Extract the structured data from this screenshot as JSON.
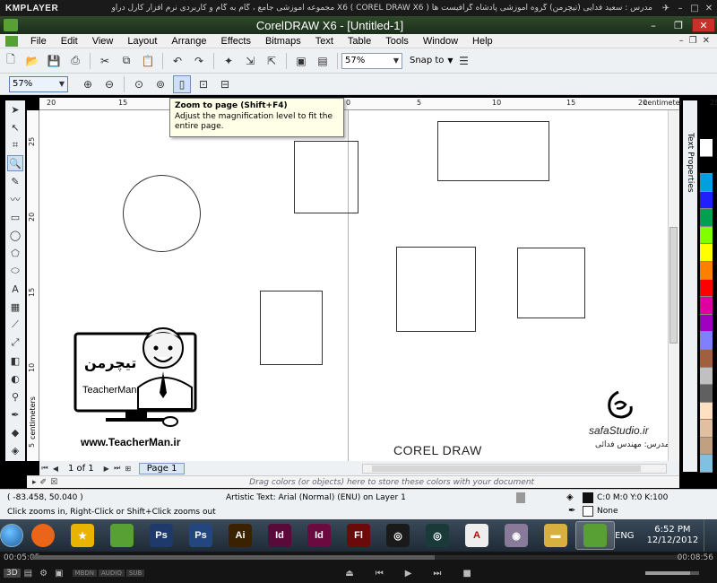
{
  "kmplayer": {
    "logo": "KMPLAYER",
    "caption": "مجموعه آموزشی جامع ، گام به گام و کاربردی نرم افزار کارل دراو X6 ( COREL DRAW X6 )   مدرس : سعید فدایی (تیچرمن) گروه آموزشی پادشاه گرافیست ها",
    "elapsed": "00:05:05",
    "total": "00:08:56",
    "seek_fraction": 0.62,
    "mode_3d": "3D",
    "modes": [
      "MBDN",
      "AUDIO",
      "SUB"
    ]
  },
  "window": {
    "title": "CorelDRAW X6 - [Untitled-1]",
    "min_icon": "minimize-icon",
    "max_icon": "maximize-icon",
    "close_icon": "close-icon"
  },
  "menu": {
    "items": [
      "File",
      "Edit",
      "View",
      "Layout",
      "Arrange",
      "Effects",
      "Bitmaps",
      "Text",
      "Table",
      "Tools",
      "Window",
      "Help"
    ]
  },
  "toolbar": {
    "zoom_value": "57%",
    "snap_label": "Snap to"
  },
  "zoombar": {
    "zoom_value": "57%"
  },
  "tooltip": {
    "title": "Zoom to page (Shift+F4)",
    "body": "Adjust the magnification level to fit the entire page."
  },
  "ruler": {
    "h_ticks": [
      {
        "label": "20",
        "value": 20
      },
      {
        "label": "15",
        "value": 15
      },
      {
        "label": "10",
        "value": 10
      },
      {
        "label": "5",
        "value": 5
      },
      {
        "label": "0",
        "value": 0
      },
      {
        "label": "5",
        "value": -5
      },
      {
        "label": "10",
        "value": -10
      },
      {
        "label": "15",
        "value": -15
      },
      {
        "label": "20",
        "value": -20
      },
      {
        "label": "25",
        "value": -25
      }
    ],
    "v_ticks": [
      "25",
      "20",
      "15",
      "10",
      "5"
    ],
    "unit": "centimeters"
  },
  "dock": {
    "label": "Text Properties"
  },
  "palette": {
    "colors": [
      "#ffffff",
      "#000000",
      "#00a0e0",
      "#2020ff",
      "#00a050",
      "#80ff00",
      "#ffff00",
      "#ff8000",
      "#ff0000",
      "#e000a0",
      "#a000c0",
      "#8080ff",
      "#a06040",
      "#c0c0c0",
      "#606060",
      "#ffe0c0",
      "#e0c0a0",
      "#c0a080",
      "#80c0e0"
    ]
  },
  "pagenav": {
    "count": "1 of 1",
    "page_tab": "Page 1"
  },
  "docpalette": {
    "hint": "Drag colors (or objects) here to store these colors with your document"
  },
  "canvas": {
    "watermark_url": "www.TeacherMan.ir",
    "logo_title": "تیچرمن",
    "logo_sub": "TeacherMan",
    "corel_text": "COREL DRAW",
    "safa_text": "safaStudio.ir",
    "safa_sub": "مدرس: مهندس فدائی"
  },
  "status": {
    "coords": "( -83.458, 50.040 )",
    "object": "Artistic Text: Arial (Normal) (ENU) on Layer 1",
    "hint": "Click zooms in, Right-Click or Shift+Click zooms out",
    "fill": "C:0 M:0 Y:0 K:100",
    "outline": "None"
  },
  "taskbar": {
    "apps": [
      {
        "name": "firefox",
        "label": "",
        "color": "#e8651a"
      },
      {
        "name": "star-app",
        "label": "★",
        "color": "#e8b400"
      },
      {
        "name": "coreldraw",
        "label": "",
        "color": "#58a034"
      },
      {
        "name": "photoshop-1",
        "label": "Ps",
        "color": "#1e3a6a"
      },
      {
        "name": "photoshop-2",
        "label": "Ps",
        "color": "#24467e"
      },
      {
        "name": "illustrator",
        "label": "Ai",
        "color": "#3a2200"
      },
      {
        "name": "indesign-1",
        "label": "Id",
        "color": "#5a0a3a"
      },
      {
        "name": "indesign-2",
        "label": "Id",
        "color": "#6a0a40"
      },
      {
        "name": "flash",
        "label": "Fl",
        "color": "#6a0a0a"
      },
      {
        "name": "app-dark-1",
        "label": "◎",
        "color": "#1a1a1a"
      },
      {
        "name": "app-dark-2",
        "label": "◎",
        "color": "#1a3a3a"
      },
      {
        "name": "acrobat",
        "label": "A",
        "color": "#eeeeee"
      },
      {
        "name": "dvd-app",
        "label": "◉",
        "color": "#8a7a9a"
      },
      {
        "name": "explorer",
        "label": "▬",
        "color": "#d8b040"
      },
      {
        "name": "coreldraw-active",
        "label": "",
        "color": "#58a034"
      }
    ],
    "lang": "ENG",
    "time": "6:52 PM",
    "date": "12/12/2012"
  }
}
